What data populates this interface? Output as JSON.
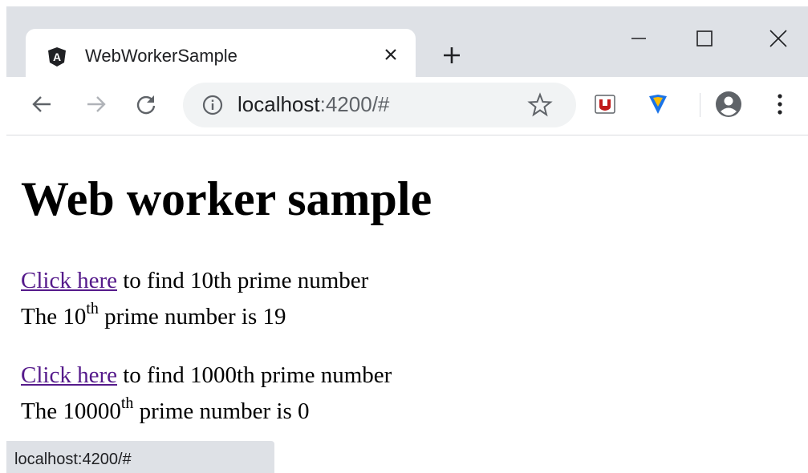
{
  "tab": {
    "title": "WebWorkerSample",
    "favicon": "angular-icon"
  },
  "toolbar": {
    "url_host": "localhost",
    "url_rest": ":4200/#"
  },
  "page": {
    "heading": "Web worker sample",
    "section1": {
      "link": "Click here",
      "text": " to find 10th prime number",
      "result_prefix": "The 10",
      "result_sup": "th",
      "result_suffix": " prime number is 19"
    },
    "section2": {
      "link": "Click here",
      "text": " to find 1000th prime number",
      "result_prefix": "The 10000",
      "result_sup": "th",
      "result_suffix": " prime number is 0"
    }
  },
  "status_bar": {
    "url": "localhost:4200/#"
  },
  "colors": {
    "titlebar": "#dee1e6",
    "link_visited": "#551a8b",
    "omnibox": "#f1f3f4"
  }
}
